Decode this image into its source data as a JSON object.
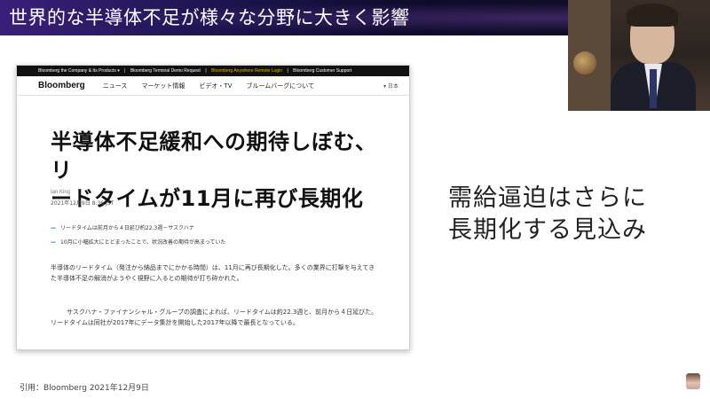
{
  "slide": {
    "title": "世界的な半導体不足が様々な分野に大きく影響",
    "caption_lines": [
      "需給逼迫はさらに",
      "長期化する見込み"
    ],
    "citation": "引用：Bloomberg 2021年12月9日"
  },
  "article": {
    "utility_bar": {
      "items": [
        "Bloomberg the Company & Its Products ▾",
        "|",
        "Bloomberg Terminal Demo Request",
        "|",
        "Bloomberg Anywhere Remote Login",
        "|",
        "Bloomberg Customer Support"
      ]
    },
    "nav": {
      "brand": "Bloomberg",
      "items": [
        "ニュース",
        "マーケット情報",
        "ビデオ・TV",
        "ブルームバーグについて"
      ],
      "lang": "▾ 日本"
    },
    "headline_lines": [
      "半導体不足緩和への期待しぼむ、リ",
      "ードタイムが11月に再び長期化"
    ],
    "author": "Ian King",
    "date": "2021年12月9日 8:36 JST",
    "bullets": [
      "リードタイムは前月から４日延び約22.3週－サスクハナ",
      "10月に小幅拡大にとどまったことで、状況改善の期待が高まっていた"
    ],
    "paragraphs": [
      "半導体のリードタイム（発注から納品までにかかる時間）は、11月に再び長期化した。多くの業界に打撃を与えてきた半導体不足の解消がようやく視野に入るとの期待が打ち砕かれた。",
      "サスクハナ・ファイナンシャル・グループの調査によれば、リードタイムは約22.3週と、前月から４日延びた。リードタイムは同社が2017年にデータ集計を開始した2017年以降で最長となっている。"
    ]
  }
}
